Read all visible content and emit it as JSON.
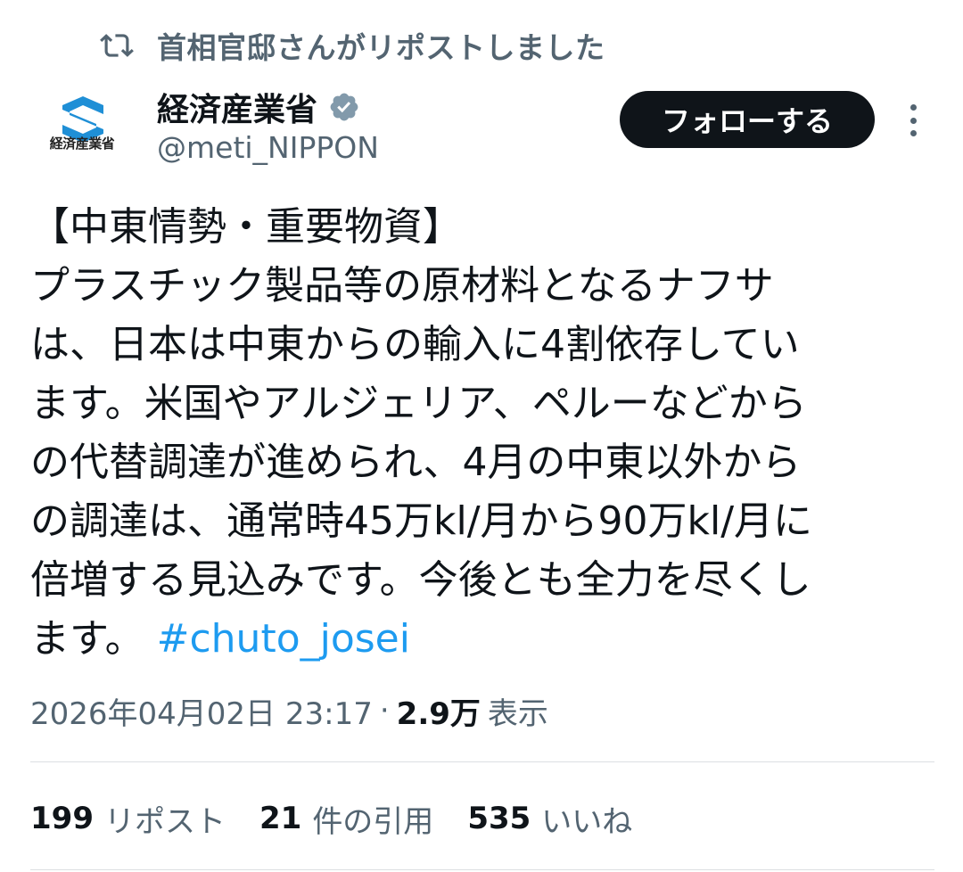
{
  "repost_context": {
    "text": "首相官邸さんがリポストしました",
    "icon": "repost-icon"
  },
  "account": {
    "avatar_label": "経済産業省",
    "display_name": "経済産業省",
    "verified_icon": "verified-badge-icon",
    "handle": "@meti_NIPPON",
    "follow_label": "フォローする"
  },
  "tweet": {
    "lines": [
      "【中東情勢・重要物資】",
      "プラスチック製品等の原材料となるナフサ",
      "は、日本は中東からの輸入に4割依存してい",
      "ます。米国やアルジェリア、ペルーなどから",
      "の代替調達が進められ、4月の中東以外から",
      "の調達は、通常時45万kl/月から90万kl/月に",
      "倍増する見込みです。今後とも全力を尽くし"
    ],
    "last_line_text": "ます。",
    "hashtag": "#chuto_josei"
  },
  "meta": {
    "timestamp": "2026年04月02日 23:17",
    "separator": "·",
    "views_count": "2.9万",
    "views_label": "表示"
  },
  "stats": {
    "reposts_count": "199",
    "reposts_label": "リポスト",
    "quotes_count": "21",
    "quotes_label": "件の引用",
    "likes_count": "535",
    "likes_label": "いいね"
  },
  "colors": {
    "text_primary": "#0f1419",
    "text_secondary": "#536471",
    "link": "#1d9bf0",
    "verified_gray": "#829aab",
    "meti_blue": "#1f8fd6"
  }
}
